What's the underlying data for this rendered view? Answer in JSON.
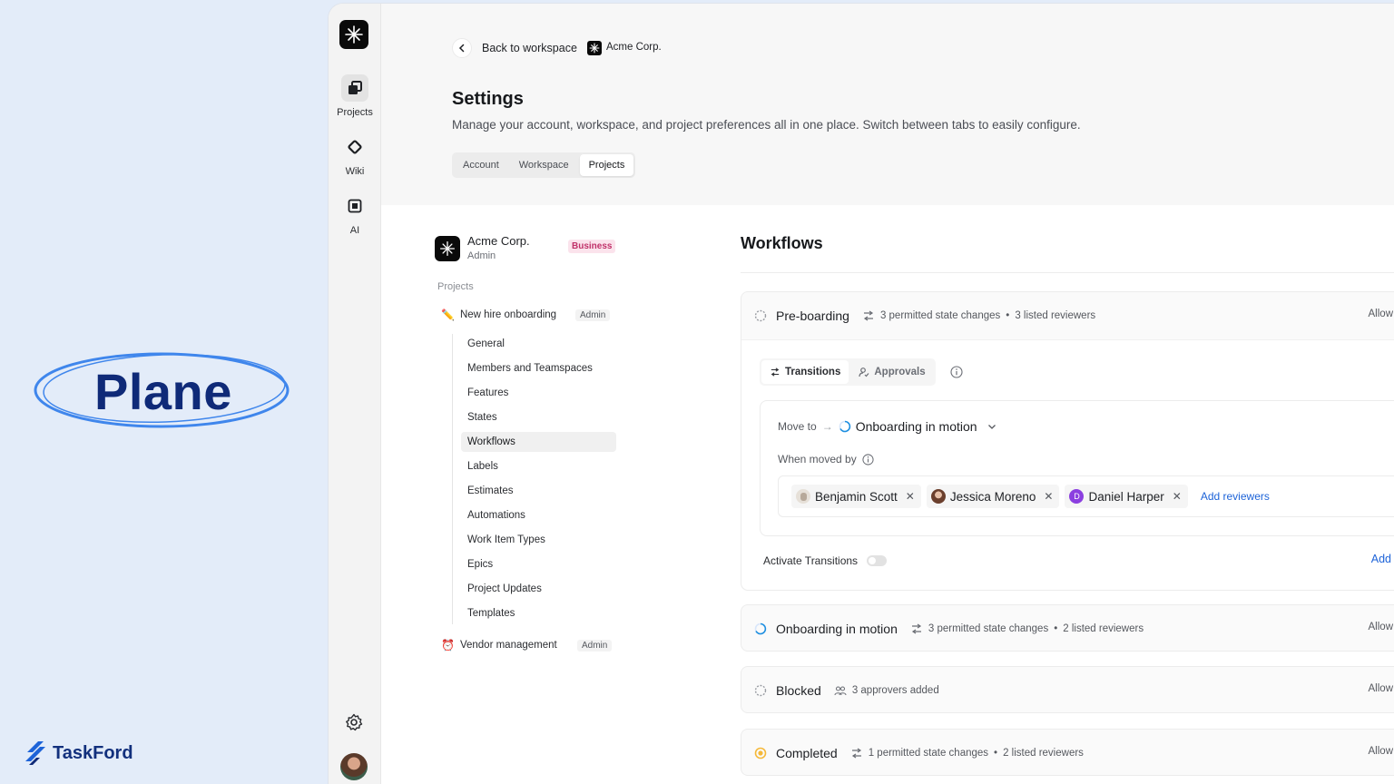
{
  "promo": {
    "title": "Plane",
    "brand": "TaskFord"
  },
  "rail": {
    "items": [
      {
        "label": "Projects",
        "icon": "projects-icon"
      },
      {
        "label": "Wiki",
        "icon": "wiki-icon"
      },
      {
        "label": "AI",
        "icon": "ai-icon"
      }
    ]
  },
  "header": {
    "back_label": "Back to workspace",
    "workspace_name": "Acme Corp.",
    "title": "Settings",
    "description": "Manage your account, workspace, and project preferences all in one place. Switch between tabs to easily configure.",
    "tabs": [
      "Account",
      "Workspace",
      "Projects"
    ],
    "active_tab": "Projects"
  },
  "sidebar": {
    "org_name": "Acme Corp.",
    "org_role": "Admin",
    "plan_badge": "Business",
    "section_label": "Projects",
    "projects": [
      {
        "name": "New hire onboarding",
        "emoji": "✏️",
        "role": "Admin"
      },
      {
        "name": "Vendor management",
        "emoji": "⏰",
        "role": "Admin"
      }
    ],
    "nav": [
      "General",
      "Members and Teamspaces",
      "Features",
      "States",
      "Workflows",
      "Labels",
      "Estimates",
      "Automations",
      "Work Item Types",
      "Epics",
      "Project Updates",
      "Templates"
    ],
    "active_nav": "Workflows"
  },
  "main": {
    "title": "Workflows",
    "states": [
      {
        "name": "Pre-boarding",
        "meta1": "3 permitted state changes",
        "meta2": "3 listed reviewers",
        "allow": "Allow"
      },
      {
        "name": "Onboarding in motion",
        "meta1": "3 permitted state changes",
        "meta2": "2 listed reviewers",
        "allow": "Allow"
      },
      {
        "name": "Blocked",
        "meta1": "3 approvers added",
        "meta2": "",
        "allow": "Allow"
      },
      {
        "name": "Completed",
        "meta1": "1 permitted state changes",
        "meta2": "2 listed reviewers",
        "allow": "Allow"
      }
    ],
    "expanded": {
      "tabs": [
        "Transitions",
        "Approvals"
      ],
      "move_to_label": "Move to",
      "move_to_target": "Onboarding in motion",
      "moved_by_label": "When moved by",
      "reviewers": [
        {
          "name": "Benjamin Scott",
          "initial": ""
        },
        {
          "name": "Jessica Moreno",
          "initial": ""
        },
        {
          "name": "Daniel Harper",
          "initial": "D"
        }
      ],
      "add_reviewers": "Add reviewers",
      "activate_label": "Activate Transitions",
      "add_label": "Add"
    }
  },
  "colors": {
    "accent": "#1d63d8",
    "brand": "#0f2a78",
    "business_badge": "#c0326a",
    "avatar_purple": "#8b3fe0"
  }
}
